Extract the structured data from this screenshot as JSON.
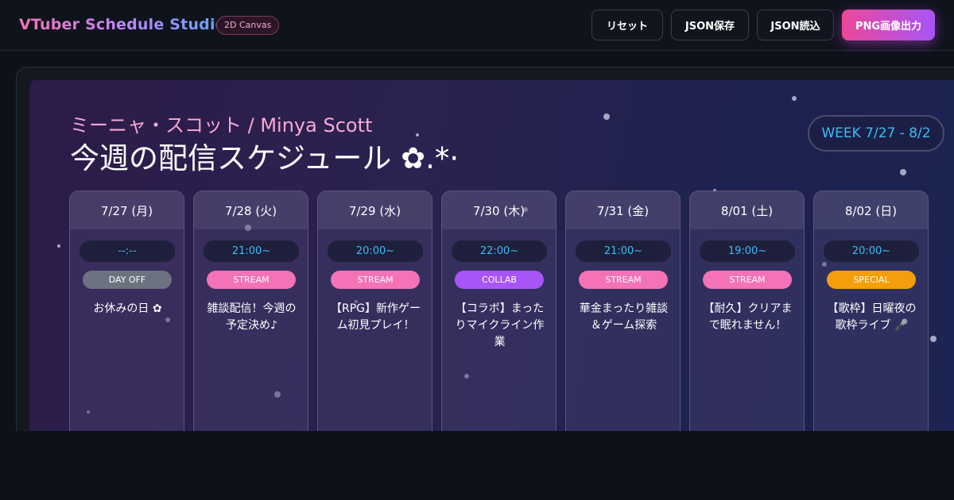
{
  "header": {
    "app_title": "VTuber Schedule Studio",
    "mode_badge": "2D Canvas",
    "buttons": {
      "reset": "リセット",
      "save_json": "JSON保存",
      "load_json": "JSON読込",
      "export_png": "PNG画像出力"
    }
  },
  "schedule": {
    "vtuber_name": "ミーニャ・スコット / Minya Scott",
    "title": "今週の配信スケジュール ✿.*·",
    "week_label": "WEEK 7/27 - 8/2",
    "days": [
      {
        "date": "7/27 (月)",
        "time": "--:--",
        "category": "DAY OFF",
        "title": "お休みの日 ✿"
      },
      {
        "date": "7/28 (火)",
        "time": "21:00~",
        "category": "STREAM",
        "title": "雑談配信！今週の予定決め♪"
      },
      {
        "date": "7/29 (水)",
        "time": "20:00~",
        "category": "STREAM",
        "title": "【RPG】新作ゲーム初見プレイ！"
      },
      {
        "date": "7/30 (木)",
        "time": "22:00~",
        "category": "COLLAB",
        "title": "【コラボ】まったりマイクライン作業"
      },
      {
        "date": "7/31 (金)",
        "time": "21:00~",
        "category": "STREAM",
        "title": "華金まったり雑談＆ゲーム探索"
      },
      {
        "date": "8/01 (土)",
        "time": "19:00~",
        "category": "STREAM",
        "title": "【耐久】クリアまで眠れません！"
      },
      {
        "date": "8/02 (日)",
        "time": "20:00~",
        "category": "SPECIAL",
        "title": "【歌枠】日曜夜の歌枠ライブ 🎤"
      }
    ]
  },
  "colors": {
    "day_off": "#6b7280",
    "stream": "#f472b6",
    "collab": "#a855f7",
    "special": "#f59e0b",
    "time_text": "#38bdf8",
    "name_text": "#f9a8d4"
  }
}
